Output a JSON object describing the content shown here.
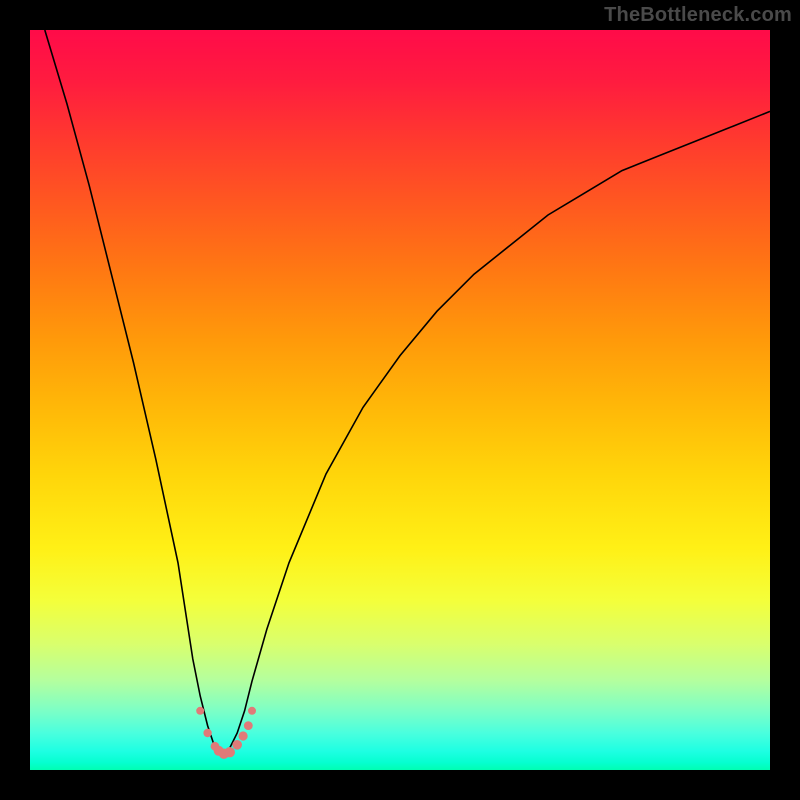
{
  "watermark": {
    "text": "TheBottleneck.com"
  },
  "colors": {
    "frame_background": "#000000",
    "curve_stroke": "#000000",
    "marker_fill": "#e07a78",
    "gradient_top": "#ff0b49",
    "gradient_mid": "#fff016",
    "gradient_bottom": "#00ffb2"
  },
  "chart_data": {
    "type": "line",
    "title": "",
    "xlabel": "",
    "ylabel": "",
    "xlim": [
      0,
      100
    ],
    "ylim": [
      0,
      100
    ],
    "grid": false,
    "optimum_x": 26,
    "series": [
      {
        "name": "bottleneck-curve",
        "x": [
          2,
          5,
          8,
          11,
          14,
          17,
          20,
          22,
          23,
          24,
          25,
          26,
          27,
          28,
          29,
          30,
          32,
          35,
          40,
          45,
          50,
          55,
          60,
          65,
          70,
          75,
          80,
          85,
          90,
          95,
          100
        ],
        "values": [
          100,
          90,
          79,
          67,
          55,
          42,
          28,
          15,
          10,
          6,
          3,
          2,
          3,
          5,
          8,
          12,
          19,
          28,
          40,
          49,
          56,
          62,
          67,
          71,
          75,
          78,
          81,
          83,
          85,
          87,
          89
        ]
      }
    ],
    "markers": {
      "name": "floor-dots",
      "x": [
        23.0,
        24.0,
        25.0,
        25.5,
        26.2,
        27.0,
        28.0,
        28.8,
        29.5,
        30.0
      ],
      "values": [
        8.0,
        5.0,
        3.2,
        2.6,
        2.2,
        2.4,
        3.4,
        4.6,
        6.0,
        8.0
      ],
      "r": [
        4.0,
        4.2,
        4.4,
        5.0,
        5.2,
        5.2,
        4.8,
        4.6,
        4.4,
        4.0
      ]
    }
  }
}
